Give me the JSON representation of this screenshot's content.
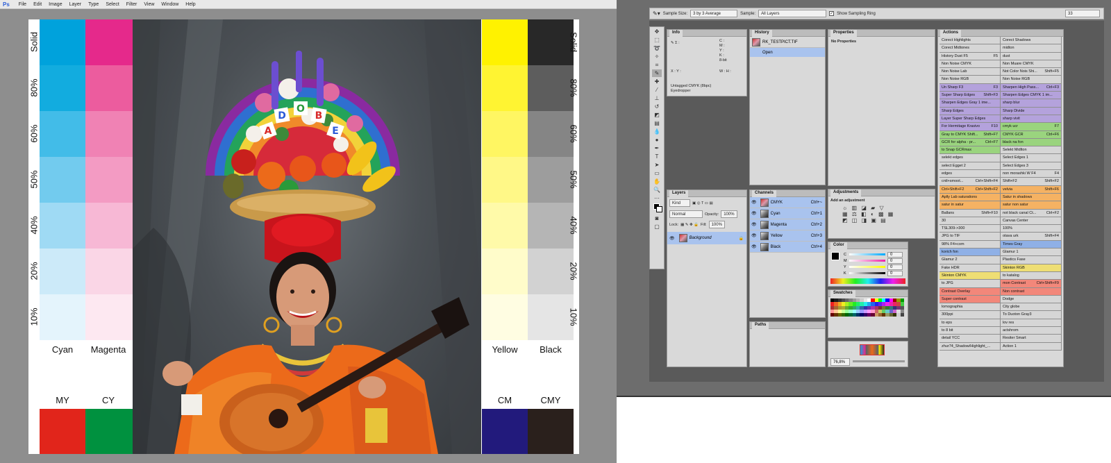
{
  "menu": {
    "logo": "Ps",
    "items": [
      "File",
      "Edit",
      "Image",
      "Layer",
      "Type",
      "Select",
      "Filter",
      "View",
      "Window",
      "Help"
    ]
  },
  "document": {
    "percent_labels_left": [
      "Solid",
      "80%",
      "60%",
      "50%",
      "40%",
      "20%",
      "10%"
    ],
    "percent_labels_right": [
      "Solid",
      "80%",
      "60%",
      "50%",
      "40%",
      "20%",
      "10%"
    ],
    "left_inks": [
      {
        "name": "Cyan",
        "colors": [
          "#00a2dc",
          "#12acdf",
          "#42bce8",
          "#72cbee",
          "#9fdaf4",
          "#cceaf9",
          "#e4f4fc"
        ]
      },
      {
        "name": "Magenta",
        "colors": [
          "#e5298b",
          "#ec5c9e",
          "#f082b4",
          "#f39bc3",
          "#f7b8d5",
          "#fad6e6",
          "#fde8f1"
        ]
      }
    ],
    "right_inks": [
      {
        "name": "Yellow",
        "colors": [
          "#fff200",
          "#fff432",
          "#fff662",
          "#fff887",
          "#fffaa9",
          "#fffcca",
          "#fffde2"
        ]
      },
      {
        "name": "Black",
        "colors": [
          "#282828",
          "#5d5d5d",
          "#858585",
          "#9d9d9d",
          "#b5b5b5",
          "#d2d2d2",
          "#e5e5e5"
        ]
      }
    ],
    "overprints_left": [
      {
        "name": "MY",
        "color": "#e1251b"
      },
      {
        "name": "CY",
        "color": "#00913f"
      }
    ],
    "overprints_right": [
      {
        "name": "CM",
        "color": "#221a7c"
      },
      {
        "name": "CMY",
        "color": "#2a201c"
      }
    ],
    "photo_letters": [
      "A",
      "D",
      "O",
      "B",
      "E"
    ]
  },
  "options": {
    "sample_size_label": "Sample Size:",
    "sample_size_value": "3 by 3 Average",
    "sample_label": "Sample:",
    "sample_value": "All Layers",
    "ring_label": "Show Sampling Ring",
    "workspace_value": "33"
  },
  "info_panel": {
    "title": "Info",
    "ch_labels": [
      "C :",
      "M :",
      "Y :",
      "K :"
    ],
    "bit": "8-bit",
    "xy": "X : Y :",
    "wh": "W : H :",
    "footer1": "Untagged CMYK (8bpc)",
    "footer2": "Eyedropper"
  },
  "history_panel": {
    "title": "History",
    "file": "RK_TESTPICT.TIF",
    "step": "Open"
  },
  "properties_panel": {
    "title": "Properties",
    "text": "No Properties"
  },
  "layers_panel": {
    "title": "Layers",
    "kind": "Kind",
    "mode": "Normal",
    "opacity_label": "Opacity:",
    "opacity": "100%",
    "lock_label": "Lock:",
    "fill_label": "Fill:",
    "fill": "100%",
    "layer_name": "Background"
  },
  "channels_panel": {
    "title": "Channels",
    "rows": [
      {
        "name": "CMYK",
        "key": "Ctrl+~"
      },
      {
        "name": "Cyan",
        "key": "Ctrl+1"
      },
      {
        "name": "Magenta",
        "key": "Ctrl+2"
      },
      {
        "name": "Yellow",
        "key": "Ctrl+3"
      },
      {
        "name": "Black",
        "key": "Ctrl+4"
      }
    ]
  },
  "paths_panel": {
    "title": "Paths"
  },
  "adjustments_panel": {
    "title": "Adjustments",
    "text": "Add an adjustment"
  },
  "color_panel": {
    "title": "Color",
    "labels": [
      "C",
      "M",
      "Y",
      "K"
    ],
    "values": [
      "0",
      "0",
      "0",
      "0"
    ]
  },
  "swatches_panel": {
    "title": "Swatches"
  },
  "navigator": {
    "zoom": "76,8%"
  },
  "actions_panel": {
    "title": "Actions",
    "rows": [
      [
        {
          "t": "Corect Highlights",
          "k": "",
          "c": "#d6d6d6"
        },
        {
          "t": "Corect Shadows",
          "k": "",
          "c": "#d6d6d6"
        }
      ],
      [
        {
          "t": "Corect Midtones",
          "k": "",
          "c": "#d6d6d6"
        },
        {
          "t": "midton",
          "k": "",
          "c": "#d6d6d6"
        }
      ],
      [
        {
          "t": "History Dust F5",
          "k": "F5",
          "c": "#d6d6d6"
        },
        {
          "t": "dust",
          "k": "",
          "c": "#d6d6d6"
        }
      ],
      [
        {
          "t": "Non Noise CMYK",
          "k": "",
          "c": "#d6d6d6"
        },
        {
          "t": "Non Muare CMYK",
          "k": "",
          "c": "#d6d6d6"
        }
      ],
      [
        {
          "t": "Non Noise Lab",
          "k": "",
          "c": "#d6d6d6"
        },
        {
          "t": "Not Color Nois Shi...",
          "k": "Shift+F5",
          "c": "#d6d6d6"
        }
      ],
      [
        {
          "t": "Non Noise RGB",
          "k": "",
          "c": "#d6d6d6"
        },
        {
          "t": "Non Noise RGB",
          "k": "",
          "c": "#d6d6d6"
        }
      ],
      [
        {
          "t": "Un Sharp F3",
          "k": "F3",
          "c": "#b4a2dc"
        },
        {
          "t": "Sharpen High Pass...",
          "k": "Ctrl+F3",
          "c": "#b4a2dc"
        }
      ],
      [
        {
          "t": "Super Sharp Edges",
          "k": "Shift+F3",
          "c": "#b4a2dc"
        },
        {
          "t": "Sharpen Edges CMYK 1 im...",
          "k": "",
          "c": "#b4a2dc"
        }
      ],
      [
        {
          "t": "Sharpen Edges Gray 1 ime...",
          "k": "",
          "c": "#b4a2dc"
        },
        {
          "t": "sharp blur",
          "k": "",
          "c": "#b4a2dc"
        }
      ],
      [
        {
          "t": "Sharp Edges",
          "k": "",
          "c": "#b4a2dc"
        },
        {
          "t": "Sharp Divide",
          "k": "",
          "c": "#b4a2dc"
        }
      ],
      [
        {
          "t": "Layer Super Sharp Edges",
          "k": "",
          "c": "#b4a2dc"
        },
        {
          "t": "sharp vivit",
          "k": "",
          "c": "#b4a2dc"
        }
      ],
      [
        {
          "t": "For Hermitage Krasivo",
          "k": "F10",
          "c": "#b4a2dc"
        },
        {
          "t": "cmyk ucr",
          "k": "F7",
          "c": "#9ad47e"
        }
      ],
      [
        {
          "t": "Gray to CMYK Shift...",
          "k": "Shift+F7",
          "c": "#9ad47e"
        },
        {
          "t": "CMYK GCR",
          "k": "Ctrl+F6",
          "c": "#9ad47e"
        }
      ],
      [
        {
          "t": "GCR for alpha - pr...",
          "k": "Ctrl+F7",
          "c": "#9ad47e"
        },
        {
          "t": "black na fon",
          "k": "",
          "c": "#9ad47e"
        }
      ],
      [
        {
          "t": "to Snap GCRmax",
          "k": "",
          "c": "#9ad47e"
        },
        {
          "t": "Selekt Midlton",
          "k": "",
          "c": "#d6d6d6"
        }
      ],
      [
        {
          "t": "selekt edges",
          "k": "",
          "c": "#d6d6d6"
        },
        {
          "t": "Select Edges 1",
          "k": "",
          "c": "#d6d6d6"
        }
      ],
      [
        {
          "t": "select Egget 2",
          "k": "",
          "c": "#d6d6d6"
        },
        {
          "t": "Select Edges 3",
          "k": "",
          "c": "#d6d6d6"
        }
      ],
      [
        {
          "t": "edges",
          "k": "",
          "c": "#d6d6d6"
        },
        {
          "t": "non morashki W F4",
          "k": "F4",
          "c": "#d6d6d6"
        }
      ],
      [
        {
          "t": "cntl+smoot...",
          "k": "Ctrl+Shift+F4",
          "c": "#d6d6d6"
        },
        {
          "t": "Shift+F2",
          "k": "Shift+F2",
          "c": "#d6d6d6"
        }
      ],
      [
        {
          "t": "Ctrl+Shift+F2",
          "k": "Ctrl+Shift+F2",
          "c": "#f5b263"
        },
        {
          "t": "velvia",
          "k": "Shift+F6",
          "c": "#f5b263"
        }
      ],
      [
        {
          "t": "Aplly Lab saturations",
          "k": "",
          "c": "#f5b263"
        },
        {
          "t": "Satur in shadows",
          "k": "",
          "c": "#f5b263"
        }
      ],
      [
        {
          "t": "satur in satur",
          "k": "",
          "c": "#f5b263"
        },
        {
          "t": "satur non satur",
          "k": "",
          "c": "#f5b263"
        }
      ],
      [
        {
          "t": "Ballans",
          "k": "Shift+F10",
          "c": "#d6d6d6"
        },
        {
          "t": "not black canal Ct...",
          "k": "Ctrl+F2",
          "c": "#d6d6d6"
        }
      ],
      [
        {
          "t": "30",
          "k": "",
          "c": "#d6d6d6"
        },
        {
          "t": "Canvas Center",
          "k": "",
          "c": "#d6d6d6"
        }
      ],
      [
        {
          "t": "TSL309->300",
          "k": "",
          "c": "#d6d6d6"
        },
        {
          "t": "100%",
          "k": "",
          "c": "#d6d6d6"
        }
      ],
      [
        {
          "t": "JPG to TIF",
          "k": "",
          "c": "#d6d6d6"
        },
        {
          "t": "otava urk",
          "k": "Shift+F4",
          "c": "#d6d6d6"
        }
      ],
      [
        {
          "t": "98% F4+com",
          "k": "",
          "c": "#d6d6d6"
        },
        {
          "t": "Times Gray",
          "k": "",
          "c": "#8fb0e6"
        }
      ],
      [
        {
          "t": "korich fon",
          "k": "",
          "c": "#8fb0e6"
        },
        {
          "t": "Glamur 1",
          "k": "",
          "c": "#d6d6d6"
        }
      ],
      [
        {
          "t": "Glamur 2",
          "k": "",
          "c": "#d6d6d6"
        },
        {
          "t": "Plastics Fase",
          "k": "",
          "c": "#d6d6d6"
        }
      ],
      [
        {
          "t": "Fake HDR",
          "k": "",
          "c": "#d6d6d6"
        },
        {
          "t": "Skinton RGB",
          "k": "",
          "c": "#eede74"
        }
      ],
      [
        {
          "t": "Skinton CMYK",
          "k": "",
          "c": "#eede74"
        },
        {
          "t": "to katalog",
          "k": "",
          "c": "#d6d6d6"
        }
      ],
      [
        {
          "t": "to JPG",
          "k": "",
          "c": "#d6d6d6"
        },
        {
          "t": "mon Contrast",
          "k": "Ctrl+Shift+F9",
          "c": "#f2877a"
        }
      ],
      [
        {
          "t": "Contrast Overlay",
          "k": "",
          "c": "#f2877a"
        },
        {
          "t": "Non contrast",
          "k": "",
          "c": "#f2877a"
        }
      ],
      [
        {
          "t": "Super contrast",
          "k": "",
          "c": "#f2877a"
        },
        {
          "t": "Dodge",
          "k": "",
          "c": "#d6d6d6"
        }
      ],
      [
        {
          "t": "lomographia",
          "k": "",
          "c": "#d6d6d6"
        },
        {
          "t": "City globe",
          "k": "",
          "c": "#d6d6d6"
        }
      ],
      [
        {
          "t": "300ppi",
          "k": "",
          "c": "#d6d6d6"
        },
        {
          "t": "To Duoton Gray3",
          "k": "",
          "c": "#d6d6d6"
        }
      ],
      [
        {
          "t": "to eps",
          "k": "",
          "c": "#d6d6d6"
        },
        {
          "t": "lov res",
          "k": "",
          "c": "#d6d6d6"
        }
      ],
      [
        {
          "t": "to 8 bit",
          "k": "",
          "c": "#d6d6d6"
        },
        {
          "t": "actshrom",
          "k": "",
          "c": "#d6d6d6"
        }
      ],
      [
        {
          "t": "detail YCC",
          "k": "",
          "c": "#d6d6d6"
        },
        {
          "t": "Resiter Smart",
          "k": "",
          "c": "#d6d6d6"
        }
      ],
      [
        {
          "t": "zhur74_Shadow/Highlight_...",
          "k": "",
          "c": "#d6d6d6"
        },
        {
          "t": "Action 1",
          "k": "",
          "c": "#d6d6d6"
        }
      ]
    ]
  }
}
